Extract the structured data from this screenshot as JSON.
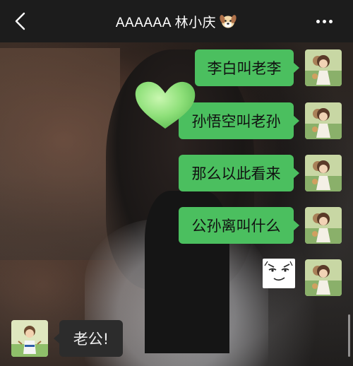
{
  "header": {
    "title": "AAAAAA 林小庆",
    "back_icon": "chevron-left-icon",
    "title_emoji_icon": "dog-face-icon",
    "more_icon": "more-dots-icon"
  },
  "messages": [
    {
      "text": "李白叫老李",
      "side": "right"
    },
    {
      "text": "孙悟空叫老孙",
      "side": "right"
    },
    {
      "text": "那么以此看来",
      "side": "right"
    },
    {
      "text": "公孙离叫什么",
      "side": "right"
    },
    {
      "sticker": "smirk-face-sticker",
      "side": "right"
    },
    {
      "text": "老公!",
      "side": "left"
    }
  ],
  "colors": {
    "bubble_self": "#4bbf5f",
    "bubble_other": "#2c2c2c",
    "header_bg": "#1c1c1c"
  }
}
